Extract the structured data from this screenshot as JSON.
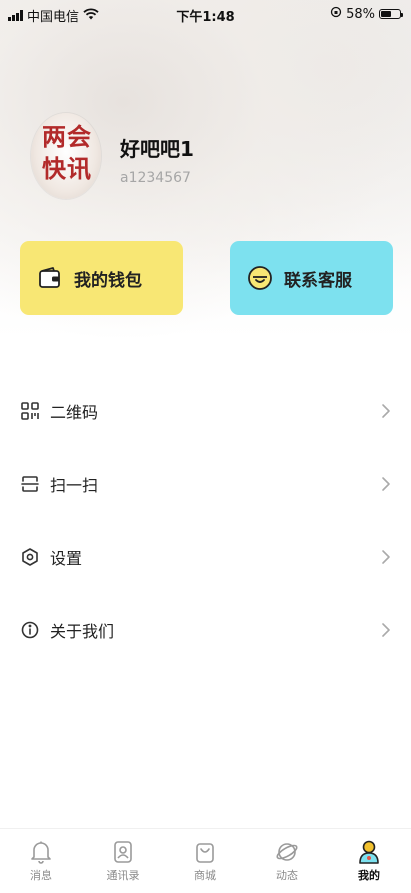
{
  "status_bar": {
    "carrier": "中国电信",
    "time": "下午1:48",
    "battery": "58%"
  },
  "profile": {
    "avatar_text_line1": "两会",
    "avatar_text_line2": "快讯",
    "username": "好吧吧1",
    "user_id": "a1234567"
  },
  "cards": {
    "wallet_label": "我的钱包",
    "service_label": "联系客服"
  },
  "menu": {
    "items": [
      {
        "label": "二维码",
        "icon": "qrcode-icon"
      },
      {
        "label": "扫一扫",
        "icon": "scan-icon"
      },
      {
        "label": "设置",
        "icon": "settings-icon"
      },
      {
        "label": "关于我们",
        "icon": "info-icon"
      }
    ]
  },
  "tabbar": {
    "tabs": [
      {
        "label": "消息",
        "icon": "bell-icon"
      },
      {
        "label": "通讯录",
        "icon": "contacts-icon"
      },
      {
        "label": "商城",
        "icon": "shopping-bag-icon"
      },
      {
        "label": "动态",
        "icon": "planet-icon"
      },
      {
        "label": "我的",
        "icon": "user-icon"
      }
    ],
    "active_index": 4
  },
  "colors": {
    "wallet_card": "#f8e774",
    "service_card": "#7de1ef",
    "active_tab_accent": "#f2c12e"
  }
}
